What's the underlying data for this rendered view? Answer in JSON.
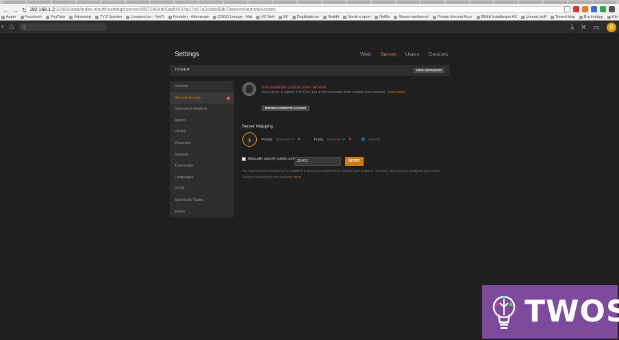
{
  "browser": {
    "url_host": "192.168.1.2",
    "url_path": ":32400/web/index.html#!/settings/server/6f972494d00adf4524a17d67a2c8de93b70eeece/remoteAccess",
    "bookmarks": [
      "Apper",
      "Facebook",
      "YouTube",
      "Adressing",
      "TV 2 Sporten",
      "Liverpool.no - YouTi",
      "Forsiden - Aftenposte",
      "CSGO Lounge - Mat",
      "VG Nett",
      "E6",
      "Dagbladet.no",
      "Reddit",
      "Norsk e-sport",
      "Netflix",
      "Steam-samfunnet",
      "Private Internet Acce",
      "BB&K Installasjon AS",
      "Unread stuff",
      "Torrent blog",
      "Bra innlegg",
      "Ubiquiti network",
      "Skole E-post",
      "[Support] Ipnoreal"
    ]
  },
  "plex_header": {
    "home_icon": "home-icon",
    "search_icon": "search-icon",
    "avatar_letter": "B"
  },
  "settings": {
    "title": "Settings",
    "tabs": [
      {
        "label": "Web",
        "active": false
      },
      {
        "label": "Server",
        "active": true
      },
      {
        "label": "Users",
        "active": false
      },
      {
        "label": "Devices",
        "active": false
      }
    ],
    "server_name": "TOWER",
    "hide_advanced_label": "HIDE ADVANCED"
  },
  "sidebar": {
    "items": [
      {
        "label": "General"
      },
      {
        "label": "Remote Access",
        "active": true,
        "warning": true
      },
      {
        "label": "Optimized Versions"
      },
      {
        "label": "Agents"
      },
      {
        "label": "Library"
      },
      {
        "label": "Channels"
      },
      {
        "label": "Network"
      },
      {
        "label": "Transcoder"
      },
      {
        "label": "Languages"
      },
      {
        "label": "DLNA"
      },
      {
        "label": "Scheduled Tasks"
      },
      {
        "label": "Extras"
      }
    ]
  },
  "remote_access": {
    "status_title": "Not available outside your network",
    "status_desc": "Your server is signed in to Plex, but is not reachable from outside your network.",
    "learn_more": "Learn more",
    "disable_button": "DISABLE REMOTE ACCESS",
    "mapping_title": "Server Mapping",
    "private_label": "Private",
    "private_value": "Unknown IP",
    "public_label": "Public",
    "public_value": "Unknown IP",
    "internet_label": "Internet",
    "manual_port_label": "Manually specify public port",
    "port_value": "32400",
    "retry_button": "RETRY",
    "help_text": "You may need to enable this to establish a direct connection from outside your network. You may also need to configure your router. Detailed instructions are available",
    "help_link": "here",
    "help_end": "."
  },
  "watermark": {
    "text": "TWOS"
  },
  "colors": {
    "accent": "#cc7b19",
    "error": "#d9534f",
    "watermark_bg": "#7d4a9c"
  }
}
